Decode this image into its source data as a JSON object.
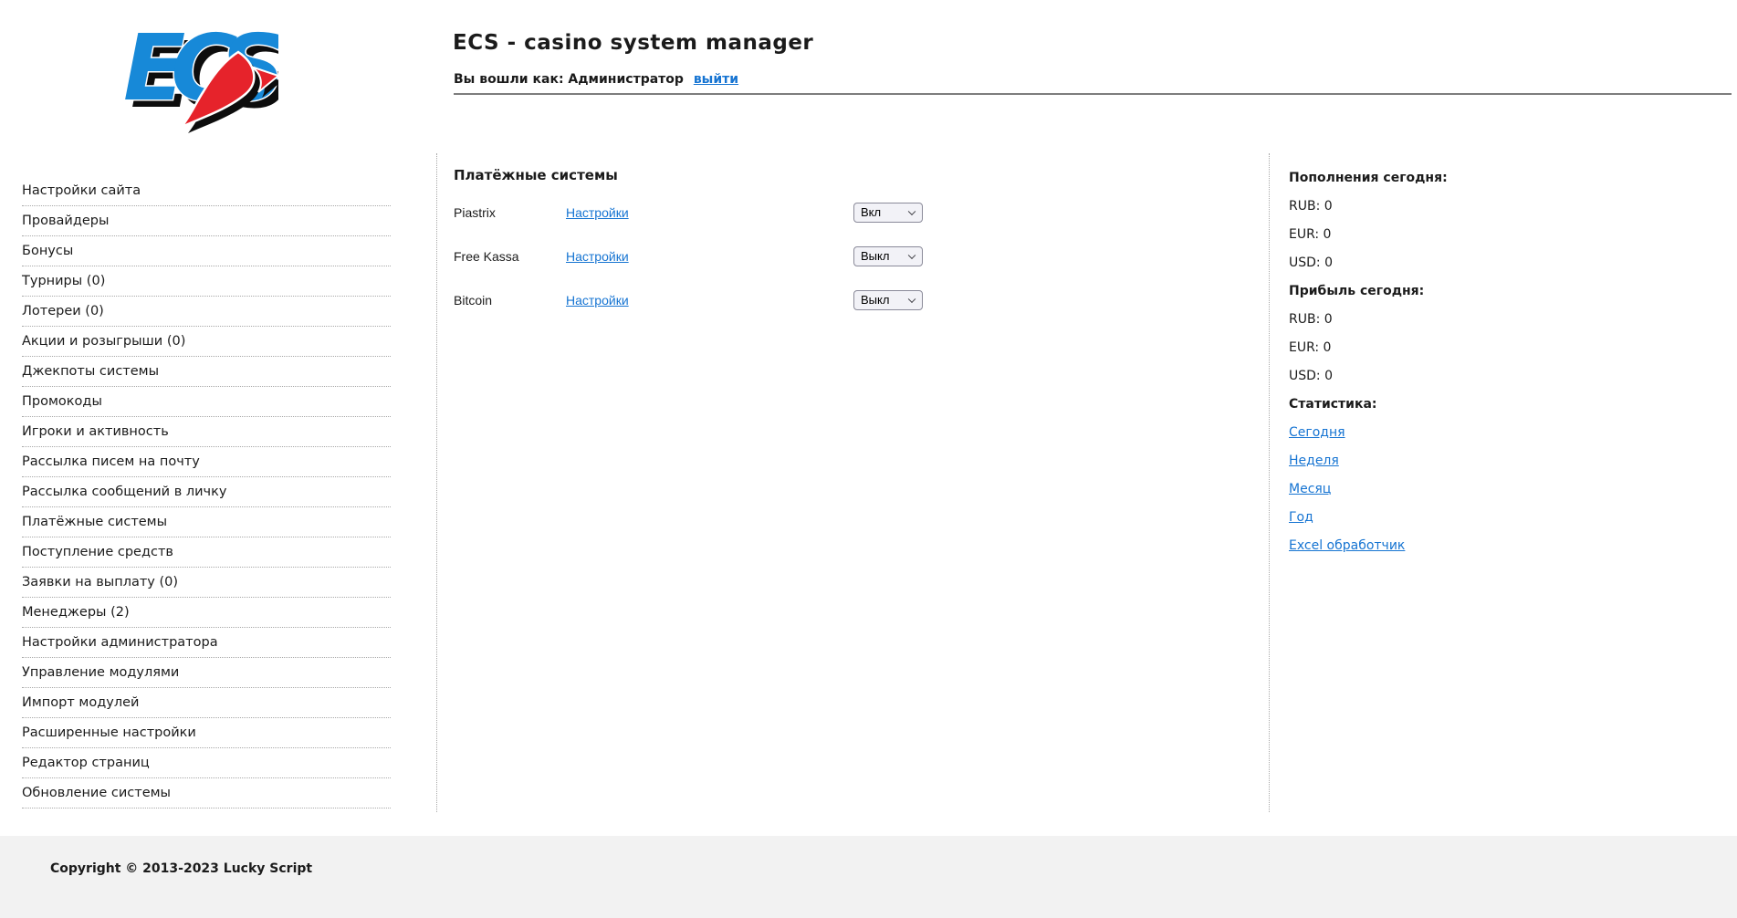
{
  "header": {
    "logo_text": "ECS",
    "title": "ECS - casino system manager",
    "login_prefix": "Вы вошли как: Администратор",
    "logout_label": "выйти"
  },
  "sidebar": {
    "items": [
      "Настройки сайта",
      "Провайдеры",
      "Бонусы",
      "Турниры (0)",
      "Лотереи (0)",
      "Акции и розыгрыши (0)",
      "Джекпоты системы",
      "Промокоды",
      "Игроки и активность",
      "Рассылка писем на почту",
      "Рассылка сообщений в личку",
      "Платёжные системы",
      "Поступление средств",
      "Заявки на выплату (0)",
      "Менеджеры (2)",
      "Настройки администратора",
      "Управление модулями",
      "Импорт модулей",
      "Расширенные настройки",
      "Редактор страниц",
      "Обновление системы"
    ]
  },
  "main": {
    "heading": "Платёжные системы",
    "rows": [
      {
        "name": "Piastrix",
        "settings": "Настройки",
        "state": "Вкл"
      },
      {
        "name": "Free Kassa",
        "settings": "Настройки",
        "state": "Выкл"
      },
      {
        "name": "Bitcoin",
        "settings": "Настройки",
        "state": "Выкл"
      }
    ]
  },
  "stats": {
    "deposits": {
      "title": "Пополнения сегодня:",
      "lines": [
        "RUB: 0",
        "EUR: 0",
        "USD: 0"
      ]
    },
    "profit": {
      "title": "Прибыль сегодня:",
      "lines": [
        "RUB: 0",
        "EUR: 0",
        "USD: 0"
      ]
    },
    "statistics": {
      "title": "Статистика:",
      "links": [
        "Сегодня",
        "Неделя",
        "Месяц",
        "Год",
        "Excel обработчик"
      ]
    }
  },
  "footer": {
    "copyright": "Copyright © 2013-2023 Lucky Script"
  },
  "colors": {
    "link": "#1674d2",
    "logo_blue": "#1789d8",
    "logo_red": "#e6232b"
  }
}
